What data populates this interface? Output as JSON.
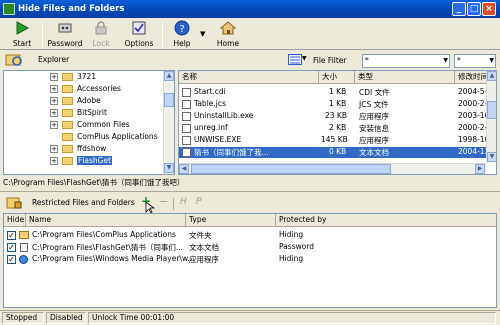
{
  "window": {
    "title": "Hide Files and Folders"
  },
  "toolbar": {
    "start_label": "Start",
    "password_label": "Password",
    "lock_label": "Lock",
    "options_label": "Options",
    "help_label": "Help",
    "home_label": "Home"
  },
  "explorer": {
    "label": "Explorer",
    "file_filter_label": "File Filter",
    "filter_value": "*",
    "filter_ext": "*"
  },
  "tree": {
    "items": [
      {
        "label": "3721"
      },
      {
        "label": "Accessories"
      },
      {
        "label": "Adobe"
      },
      {
        "label": "BitSpirit"
      },
      {
        "label": "Common Files"
      },
      {
        "label": "ComPlus Applications"
      },
      {
        "label": "ffdshow"
      },
      {
        "label": "FlashGet"
      }
    ]
  },
  "files": {
    "columns": [
      "名称",
      "大小",
      "类型",
      "修改时间"
    ],
    "rows": [
      {
        "name": "Start.cdi",
        "size": "1 KB",
        "type": "CDI 文件",
        "date": "2004-5-"
      },
      {
        "name": "Table.jcs",
        "size": "1 KB",
        "type": "JCS 文件",
        "date": "2000-2-"
      },
      {
        "name": "UninstallLib.exe",
        "size": "23 KB",
        "type": "应用程序",
        "date": "2003-10-"
      },
      {
        "name": "unreg.inf",
        "size": "2 KB",
        "type": "安装信息",
        "date": "2000-2-"
      },
      {
        "name": "UNWISE.EXE",
        "size": "145 KB",
        "type": "应用程序",
        "date": "1998-10-"
      },
      {
        "name": "猜书（同事们饿了我...",
        "size": "0 KB",
        "type": "文本文档",
        "date": "2004-12-"
      }
    ]
  },
  "path": {
    "current": "C:\\Program Files\\FlashGet\\猜书（同事们饿了我吧）"
  },
  "restricted": {
    "title": "Restricted Files and Folders",
    "add": "+",
    "remove": "−",
    "hide_h": "H",
    "protect_p": "P",
    "columns": [
      "Hide",
      "Name",
      "Type",
      "Protected by"
    ],
    "rows": [
      {
        "name": "C:\\Program Files\\ComPlus Applications",
        "type": "文件夹",
        "protected": "Hiding"
      },
      {
        "name": "C:\\Program Files\\FlashGet\\猜书（同事们...",
        "type": "文本文档",
        "protected": "Password"
      },
      {
        "name": "C:\\Program Files\\Windows Media Player\\w...",
        "type": "应用程序",
        "protected": "Hiding"
      }
    ]
  },
  "status": {
    "state": "Stopped",
    "mode": "Disabled",
    "unlock": "Unlock Time 00:01:00"
  }
}
